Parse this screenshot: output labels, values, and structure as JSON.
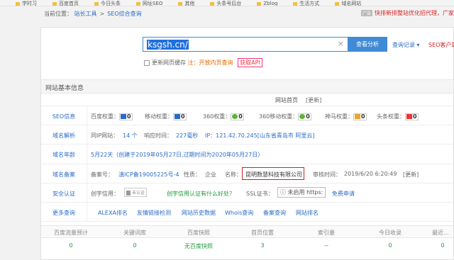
{
  "bookmarks": [
    "学时习",
    "百度首页",
    "今日头条",
    "网址SEO",
    "其他",
    "头条号后台",
    "Zblog",
    "生活方式",
    "域名网站"
  ],
  "breadcrumb": {
    "prefix": "当前位置：",
    "home": "站长工具",
    "sep": ">",
    "current": "SEO综合查询"
  },
  "promo": {
    "tag": "广告",
    "text": "快排新排整站优化招代理，广家"
  },
  "search": {
    "value": "ksgsh.cn/",
    "button": "查看分析",
    "records": "查询记录",
    "seo_client": "SEO客户端"
  },
  "options": {
    "update_cache": "更新网页缓存",
    "note": "注：开放内页查询",
    "api": "获取API"
  },
  "panel_title": "网站基本信息",
  "homepage": {
    "label": "网站首页",
    "update": "[更新]"
  },
  "seo": {
    "label": "SEO信息",
    "items": [
      {
        "name": "百度权重：",
        "value": "0"
      },
      {
        "name": "移动权重：",
        "value": "0"
      },
      {
        "name": "360权重：",
        "value": "0"
      },
      {
        "name": "360移动权重：",
        "value": "0"
      },
      {
        "name": "神马权重：",
        "value": "0"
      },
      {
        "name": "头条权重：",
        "value": "0"
      }
    ]
  },
  "resolve": {
    "label": "域名解析",
    "same_ip": "同IP网站：",
    "same_ip_count": "14 个",
    "resp": "响应时间：",
    "resp_val": "227毫秒",
    "ip": "IP：121.42.70.245[山东省青岛市 阿里云]"
  },
  "age": {
    "label": "域名年龄",
    "text": "5月22天（创建于2019年05月27日,过期时间为2020年05月27日）"
  },
  "icp": {
    "label": "域名备案",
    "num_label": "备案号：",
    "num": "滇ICP备19005225号-4",
    "nature_label": "性质：",
    "nature": "企业",
    "name_label": "名称：",
    "name": "昆明数慧科技有限公司",
    "audit_label": "审核时间：",
    "audit": "2019/6/20 6:20:49",
    "update": "[更新]"
  },
  "security": {
    "label": "安全认证",
    "credit_label": "创宇信用：",
    "badge": "未认证",
    "ask": "创宇信用认证有什么好处？",
    "ssl_label": "SSL证书：",
    "https": "未启用 https:",
    "apply": "免费申请"
  },
  "more": {
    "label": "更多查询",
    "links": [
      "ALEXA排名",
      "友情链接检测",
      "网站历史数据",
      "Whois查询",
      "备案查询",
      "网站排名"
    ]
  },
  "table": {
    "headers": [
      "百度流量预计",
      "关键词库",
      "百度快照",
      "首页位置",
      "索引量",
      "今日收录",
      "最近..."
    ],
    "values": [
      "0",
      "0",
      "无百度快照",
      "3",
      "--",
      "0",
      "0"
    ]
  }
}
